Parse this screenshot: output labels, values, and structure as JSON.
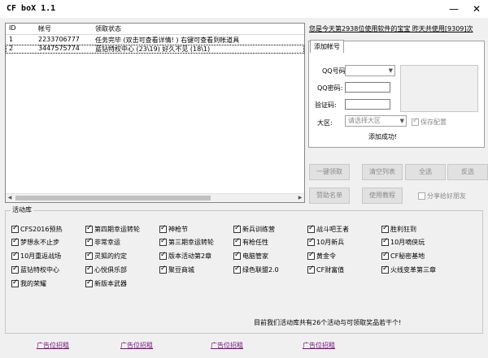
{
  "window": {
    "title": "CF boX 1.1",
    "minimize": "—",
    "close": "✕"
  },
  "list": {
    "columns": [
      "ID",
      "帐号",
      "领取状态"
    ],
    "rows": [
      {
        "id": "1",
        "account": "2233706777",
        "status": "任务完毕 (双击可查看详情! ) 右键可查看到帐道具"
      },
      {
        "id": "2",
        "account": "3447575774",
        "status": "蓝钻特权中心 (23\\19) 好久不见 (18\\1)"
      }
    ]
  },
  "notice": "您是今天第2938位使用软件的宝宝   昨天共使用[9309]次",
  "add_account": {
    "tab": "添加帐号",
    "qq_label": "QQ号码:",
    "pwd_label": "QQ密码:",
    "captcha_label": "验证码:",
    "region_label": "大区:",
    "region_placeholder": "请选择大区",
    "save_config": "保存配置",
    "status": "添加成功!"
  },
  "buttons": {
    "claim": "一键领取",
    "clear": "清空列表",
    "select_all": "全选",
    "invert": "反选",
    "sponsor": "赞助名单",
    "tutorial": "使用教程",
    "share": "分享给好朋友"
  },
  "activities": {
    "title": "活动库",
    "items": [
      {
        "label": "CFS2016预热",
        "checked": true
      },
      {
        "label": "第四期幸运转轮",
        "checked": true
      },
      {
        "label": "神枪节",
        "checked": true
      },
      {
        "label": "新兵训练营",
        "checked": true
      },
      {
        "label": "战斗吧王者",
        "checked": true
      },
      {
        "label": "胜利狂到",
        "checked": true
      },
      {
        "label": "梦想永不止步",
        "checked": true
      },
      {
        "label": "非常幸运",
        "checked": true
      },
      {
        "label": "第三期幸运转轮",
        "checked": true
      },
      {
        "label": "有枪任性",
        "checked": true
      },
      {
        "label": "10月新兵",
        "checked": true
      },
      {
        "label": "10月嘀侠玩",
        "checked": true
      },
      {
        "label": "10月重返战场",
        "checked": true
      },
      {
        "label": "灵狐的约定",
        "checked": true
      },
      {
        "label": "版本活动第2章",
        "checked": true
      },
      {
        "label": "电脑管家",
        "checked": true
      },
      {
        "label": "黄金令",
        "checked": true
      },
      {
        "label": "CF秘密基地",
        "checked": true
      },
      {
        "label": "蓝钻特权中心",
        "checked": true
      },
      {
        "label": "心悦俱乐部",
        "checked": true
      },
      {
        "label": "聚豆商城",
        "checked": true
      },
      {
        "label": "绿色联盟2.0",
        "checked": true
      },
      {
        "label": "CF财富值",
        "checked": true
      },
      {
        "label": "火线变革第三章",
        "checked": true
      },
      {
        "label": "我的荣耀",
        "checked": true
      },
      {
        "label": "新版本武器",
        "checked": true
      }
    ],
    "summary": "目前我们活动库共有26个活动与可领取奖品若干个!"
  },
  "ads": [
    "广告位招租",
    "广告位招租",
    "广告位招租",
    "广告位招租"
  ],
  "colors": {
    "ad_link": "#7a0f7a",
    "background": "#f0f0f0"
  }
}
